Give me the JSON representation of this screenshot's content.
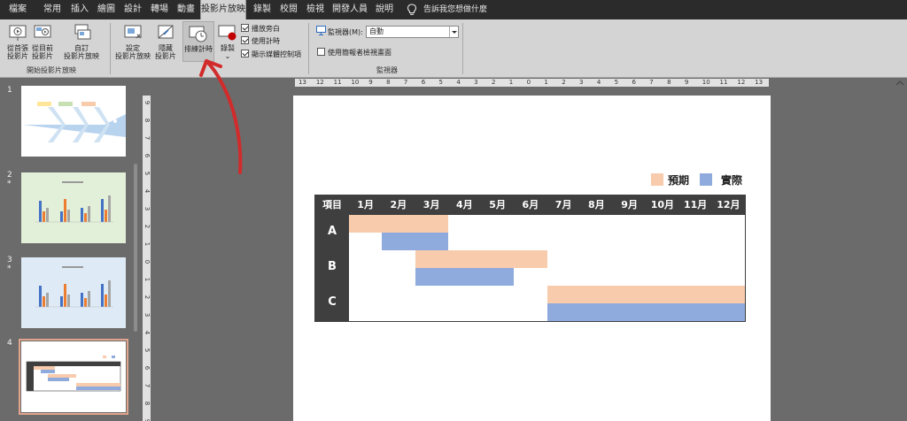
{
  "tabs": [
    "檔案",
    "常用",
    "插入",
    "繪圖",
    "設計",
    "轉場",
    "動畫",
    "投影片放映",
    "錄製",
    "校閱",
    "檢視",
    "開發人員",
    "說明"
  ],
  "active_tab": "投影片放映",
  "tell_me": "告訴我您想做什麼",
  "ribbon": {
    "start_group": {
      "label": "開始投影片放映",
      "from_beginning": [
        "從首張",
        "投影片"
      ],
      "from_current": [
        "從目前",
        "投影片"
      ],
      "custom_show": [
        "自訂",
        "投影片放映"
      ]
    },
    "setup_group": {
      "setup_show": [
        "設定",
        "投影片放映"
      ],
      "hide_slide": [
        "隱藏",
        "投影片"
      ],
      "rehearse_timings": "排練計時",
      "record": "錄製",
      "play_narrations": "播放旁白",
      "use_timings": "使用計時",
      "show_media_controls": "顯示媒體控制項",
      "play_narrations_checked": true,
      "use_timings_checked": true,
      "show_media_controls_checked": true
    },
    "monitors_group": {
      "label": "監視器",
      "monitor_label": "監視器(M):",
      "monitor_value": "自動",
      "presenter_view": "使用簡報者檢視畫面",
      "presenter_view_checked": false
    }
  },
  "thumbnails": [
    {
      "number": "1",
      "star": "",
      "theme": "fishbone"
    },
    {
      "number": "2",
      "star": "*",
      "theme": "bars-green"
    },
    {
      "number": "3",
      "star": "*",
      "theme": "bars-blue"
    },
    {
      "number": "4",
      "star": "",
      "theme": "gantt",
      "selected": true
    }
  ],
  "hruler_labels": [
    "13",
    "12",
    "11",
    "10",
    "9",
    "8",
    "7",
    "6",
    "5",
    "4",
    "3",
    "2",
    "1",
    "0",
    "1",
    "2",
    "3",
    "4",
    "5",
    "6",
    "7",
    "8",
    "9",
    "10",
    "11",
    "12",
    "13"
  ],
  "vruler_labels": [
    "9",
    "8",
    "7",
    "6",
    "5",
    "4",
    "3",
    "2",
    "1",
    "0",
    "1",
    "2",
    "3",
    "4",
    "5",
    "6",
    "7",
    "8",
    "9"
  ],
  "slide": {
    "legend": [
      {
        "label": "預期",
        "color": "#f8cbad"
      },
      {
        "label": "實際",
        "color": "#8faadc"
      }
    ],
    "gantt": {
      "corner": "項目",
      "months": [
        "1月",
        "2月",
        "3月",
        "4月",
        "5月",
        "6月",
        "7月",
        "8月",
        "9月",
        "10月",
        "11月",
        "12月"
      ],
      "rows": [
        {
          "label": "A",
          "plan": [
            1,
            3
          ],
          "actual": [
            2,
            3
          ]
        },
        {
          "label": "B",
          "plan": [
            3,
            6
          ],
          "actual": [
            3,
            5
          ]
        },
        {
          "label": "C",
          "plan": [
            7,
            12
          ],
          "actual": [
            7,
            12
          ]
        }
      ]
    }
  },
  "colors": {
    "plan": "#f8cbad",
    "actual": "#8faadc",
    "header": "#3f3f3f",
    "arrow": "#d22b2b"
  }
}
